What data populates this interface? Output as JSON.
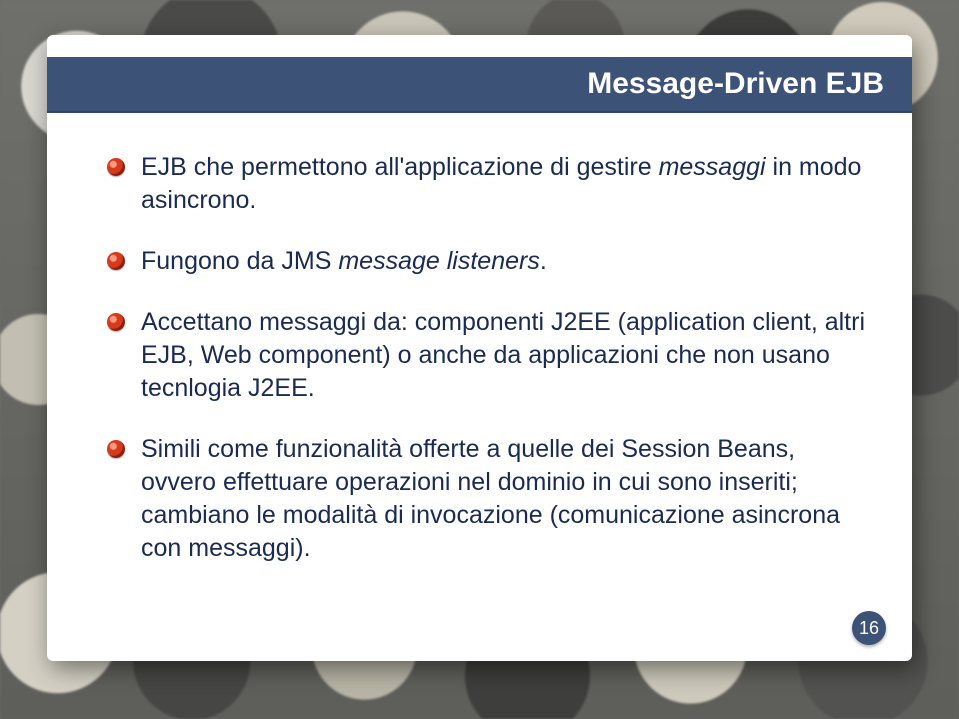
{
  "slide": {
    "title": "Message-Driven EJB",
    "bullets": [
      {
        "pre": "EJB che permettono all'applicazione di gestire ",
        "em": "messaggi",
        "post": " in modo asincrono."
      },
      {
        "pre": "Fungono da JMS ",
        "em": "message listeners",
        "post": "."
      },
      {
        "pre": "Accettano messaggi da: componenti J2EE (application client, altri EJB, Web component) o anche da applicazioni che non usano tecnlogia J2EE.",
        "em": "",
        "post": ""
      },
      {
        "pre": "Simili come funzionalità offerte a quelle dei Session Beans, ovvero effettuare operazioni nel dominio in cui sono inseriti; cambiano le modalità di invocazione (comunicazione asincrona con messaggi).",
        "em": "",
        "post": ""
      }
    ],
    "page_number": "16"
  },
  "colors": {
    "title_bar": "#3c5277",
    "body_text": "#1a2a52",
    "bullet": "#d63a1e"
  }
}
